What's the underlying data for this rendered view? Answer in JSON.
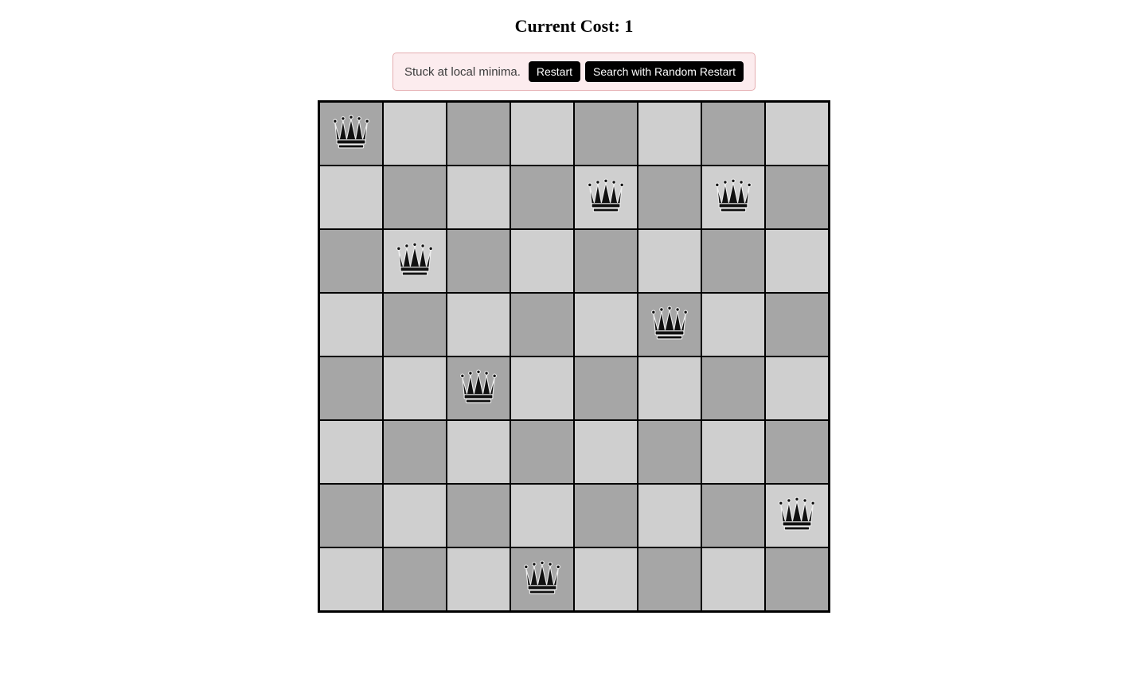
{
  "header": {
    "cost_label": "Current Cost: ",
    "cost_value": "1"
  },
  "alert": {
    "message": "Stuck at local minima.",
    "restart_label": "Restart",
    "random_restart_label": "Search with Random Restart"
  },
  "board": {
    "size": 8,
    "queens": [
      {
        "row": 0,
        "col": 0
      },
      {
        "row": 1,
        "col": 4
      },
      {
        "row": 1,
        "col": 6
      },
      {
        "row": 2,
        "col": 1
      },
      {
        "row": 3,
        "col": 5
      },
      {
        "row": 4,
        "col": 2
      },
      {
        "row": 6,
        "col": 7
      },
      {
        "row": 7,
        "col": 3
      }
    ]
  }
}
